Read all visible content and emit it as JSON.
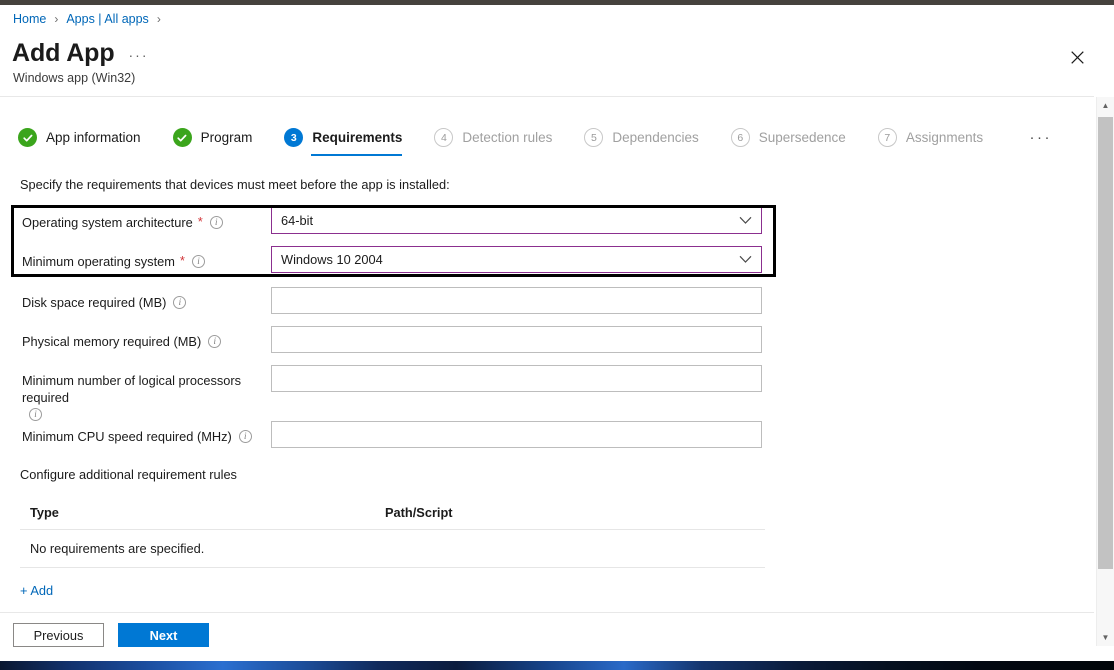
{
  "breadcrumb": {
    "items": [
      "Home",
      "Apps | All apps"
    ],
    "separator": "›"
  },
  "header": {
    "title": "Add App",
    "subtitle": "Windows app (Win32)",
    "ellipsis": "···",
    "close_icon": "close-icon"
  },
  "steps": {
    "items": [
      {
        "badge": "✓",
        "label": "App information",
        "state": "done"
      },
      {
        "badge": "✓",
        "label": "Program",
        "state": "done"
      },
      {
        "badge": "3",
        "label": "Requirements",
        "state": "active"
      },
      {
        "badge": "4",
        "label": "Detection rules",
        "state": "todo"
      },
      {
        "badge": "5",
        "label": "Dependencies",
        "state": "todo"
      },
      {
        "badge": "6",
        "label": "Supersedence",
        "state": "todo"
      },
      {
        "badge": "7",
        "label": "Assignments",
        "state": "todo"
      }
    ],
    "overflow": "···"
  },
  "main": {
    "intro": "Specify the requirements that devices must meet before the app is installed:",
    "required_marker": "*",
    "info_glyph": "i",
    "fields": [
      {
        "label": "Operating system architecture",
        "required": true,
        "type": "select",
        "value": "64-bit",
        "accent": true
      },
      {
        "label": "Minimum operating system",
        "required": true,
        "type": "select",
        "value": "Windows 10 2004",
        "accent": true
      },
      {
        "label": "Disk space required (MB)",
        "required": false,
        "type": "text",
        "value": "",
        "placeholder": ""
      },
      {
        "label": "Physical memory required (MB)",
        "required": false,
        "type": "text",
        "value": "",
        "placeholder": ""
      },
      {
        "label": "Minimum number of logical processors required",
        "required": false,
        "type": "text",
        "value": "",
        "placeholder": ""
      },
      {
        "label": "Minimum CPU speed required (MHz)",
        "required": false,
        "type": "text",
        "value": "",
        "placeholder": ""
      }
    ],
    "configure_label": "Configure additional requirement rules",
    "rules_table": {
      "columns": [
        "Type",
        "Path/Script"
      ],
      "empty_message": "No requirements are specified."
    },
    "add_link": "+ Add"
  },
  "footer": {
    "previous_label": "Previous",
    "next_label": "Next"
  },
  "colors": {
    "accent_blue": "#0078d4",
    "link_blue": "#0067b8",
    "success_green": "#3ba51c",
    "required_red": "#d13438",
    "field_accent_purple": "#8b2f8f",
    "highlight_black": "#000000"
  }
}
